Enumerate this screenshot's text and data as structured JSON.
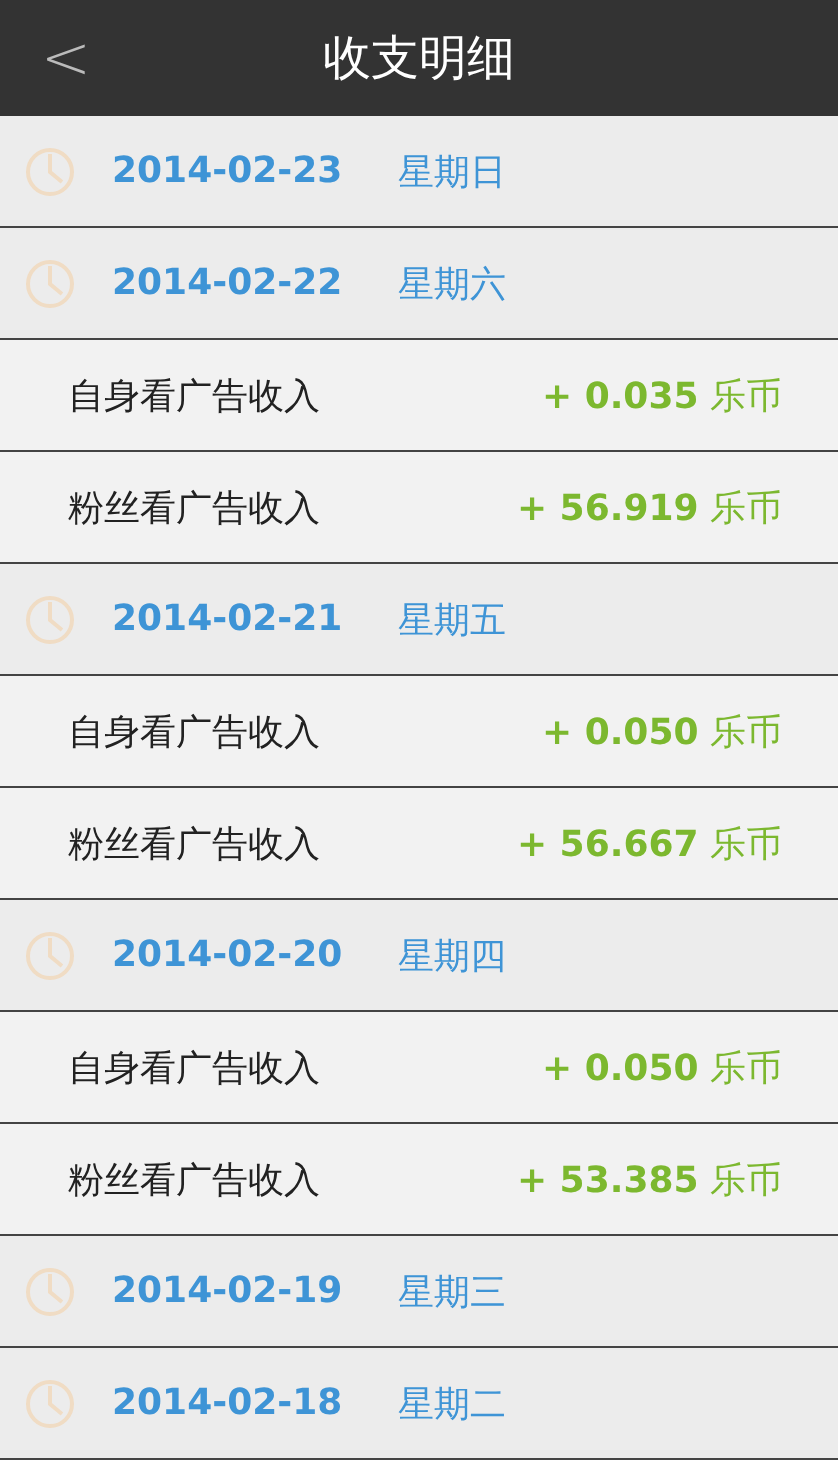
{
  "header": {
    "back": "<",
    "title": "收支明细"
  },
  "days": [
    {
      "date": "2014-02-23",
      "weekday": "星期日"
    },
    {
      "date": "2014-02-22",
      "weekday": "星期六",
      "entries": [
        {
          "label": "自身看广告收入",
          "amount": "+ 0.035",
          "unit": "乐币"
        },
        {
          "label": "粉丝看广告收入",
          "amount": "+ 56.919",
          "unit": "乐币"
        }
      ]
    },
    {
      "date": "2014-02-21",
      "weekday": "星期五",
      "entries": [
        {
          "label": "自身看广告收入",
          "amount": "+ 0.050",
          "unit": "乐币"
        },
        {
          "label": "粉丝看广告收入",
          "amount": "+ 56.667",
          "unit": "乐币"
        }
      ]
    },
    {
      "date": "2014-02-20",
      "weekday": "星期四",
      "entries": [
        {
          "label": "自身看广告收入",
          "amount": "+ 0.050",
          "unit": "乐币"
        },
        {
          "label": "粉丝看广告收入",
          "amount": "+ 53.385",
          "unit": "乐币"
        }
      ]
    },
    {
      "date": "2014-02-19",
      "weekday": "星期三"
    },
    {
      "date": "2014-02-18",
      "weekday": "星期二"
    }
  ]
}
